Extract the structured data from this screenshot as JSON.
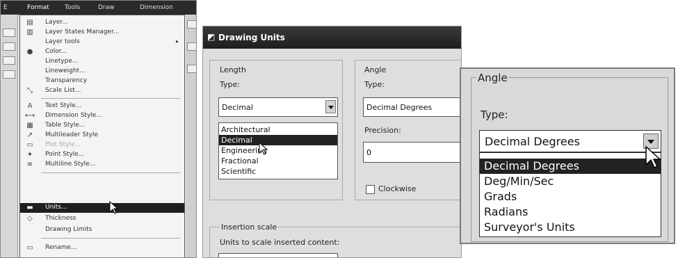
{
  "format_menu": {
    "menubar": [
      "Format",
      "Tools",
      "Draw",
      "Dimension"
    ],
    "items": [
      {
        "icon": "layers-icon",
        "glyph": "▤",
        "label": "Layer..."
      },
      {
        "icon": "layer-states-icon",
        "glyph": "▥",
        "label": "Layer States Manager..."
      },
      {
        "icon": "",
        "glyph": "",
        "label": "Layer tools",
        "submenu": "▸"
      },
      {
        "icon": "color-icon",
        "glyph": "●",
        "label": "Color..."
      },
      {
        "icon": "",
        "glyph": "",
        "label": "Linetype..."
      },
      {
        "icon": "",
        "glyph": "",
        "label": "Lineweight..."
      },
      {
        "icon": "",
        "glyph": "",
        "label": "Transparency"
      },
      {
        "icon": "scale-list-icon",
        "glyph": "⤡",
        "label": "Scale List..."
      },
      {
        "icon": "text-style-icon",
        "glyph": "A",
        "label": "Text Style..."
      },
      {
        "icon": "dimension-style-icon",
        "glyph": "⟷",
        "label": "Dimension Style..."
      },
      {
        "icon": "table-style-icon",
        "glyph": "▦",
        "label": "Table Style..."
      },
      {
        "icon": "multileader-style-icon",
        "glyph": "↗",
        "label": "Multileader Style"
      },
      {
        "icon": "plot-style-icon",
        "glyph": "▭",
        "label": "Plot Style..."
      },
      {
        "icon": "point-style-icon",
        "glyph": "✦",
        "label": "Point Style..."
      },
      {
        "icon": "multiline-style-icon",
        "glyph": "≡",
        "label": "Multiline Style..."
      },
      {
        "icon": "units-icon",
        "glyph": "▬",
        "label": "Units..."
      },
      {
        "icon": "thickness-icon",
        "glyph": "◇",
        "label": "Thickness"
      },
      {
        "icon": "",
        "glyph": "",
        "label": "Drawing Limits"
      },
      {
        "icon": "rename-icon",
        "glyph": "▭",
        "label": "Rename..."
      }
    ],
    "selected_label": "Units..."
  },
  "drawing_units": {
    "title": "Drawing Units",
    "title_icon": "drawing-units-icon",
    "length": {
      "group_label": "Length",
      "type_label": "Type:",
      "value": "Decimal",
      "options": [
        "Architectural",
        "Decimal",
        "Engineering",
        "Fractional",
        "Scientific"
      ],
      "highlighted": "Decimal"
    },
    "angle": {
      "group_label": "Angle",
      "type_label": "Type:",
      "value": "Decimal Degrees",
      "precision_label": "Precision:",
      "precision_value": "0",
      "clockwise_label": "Clockwise",
      "clockwise_checked": false
    },
    "insertion": {
      "group_label": "Insertion scale",
      "units_label": "Units to scale inserted content:"
    }
  },
  "angle_zoom": {
    "group_label": "Angle",
    "type_label": "Type:",
    "value": "Decimal Degrees",
    "options": [
      "Decimal Degrees",
      "Deg/Min/Sec",
      "Grads",
      "Radians",
      "Surveyor's Units"
    ],
    "highlighted": "Decimal Degrees"
  }
}
